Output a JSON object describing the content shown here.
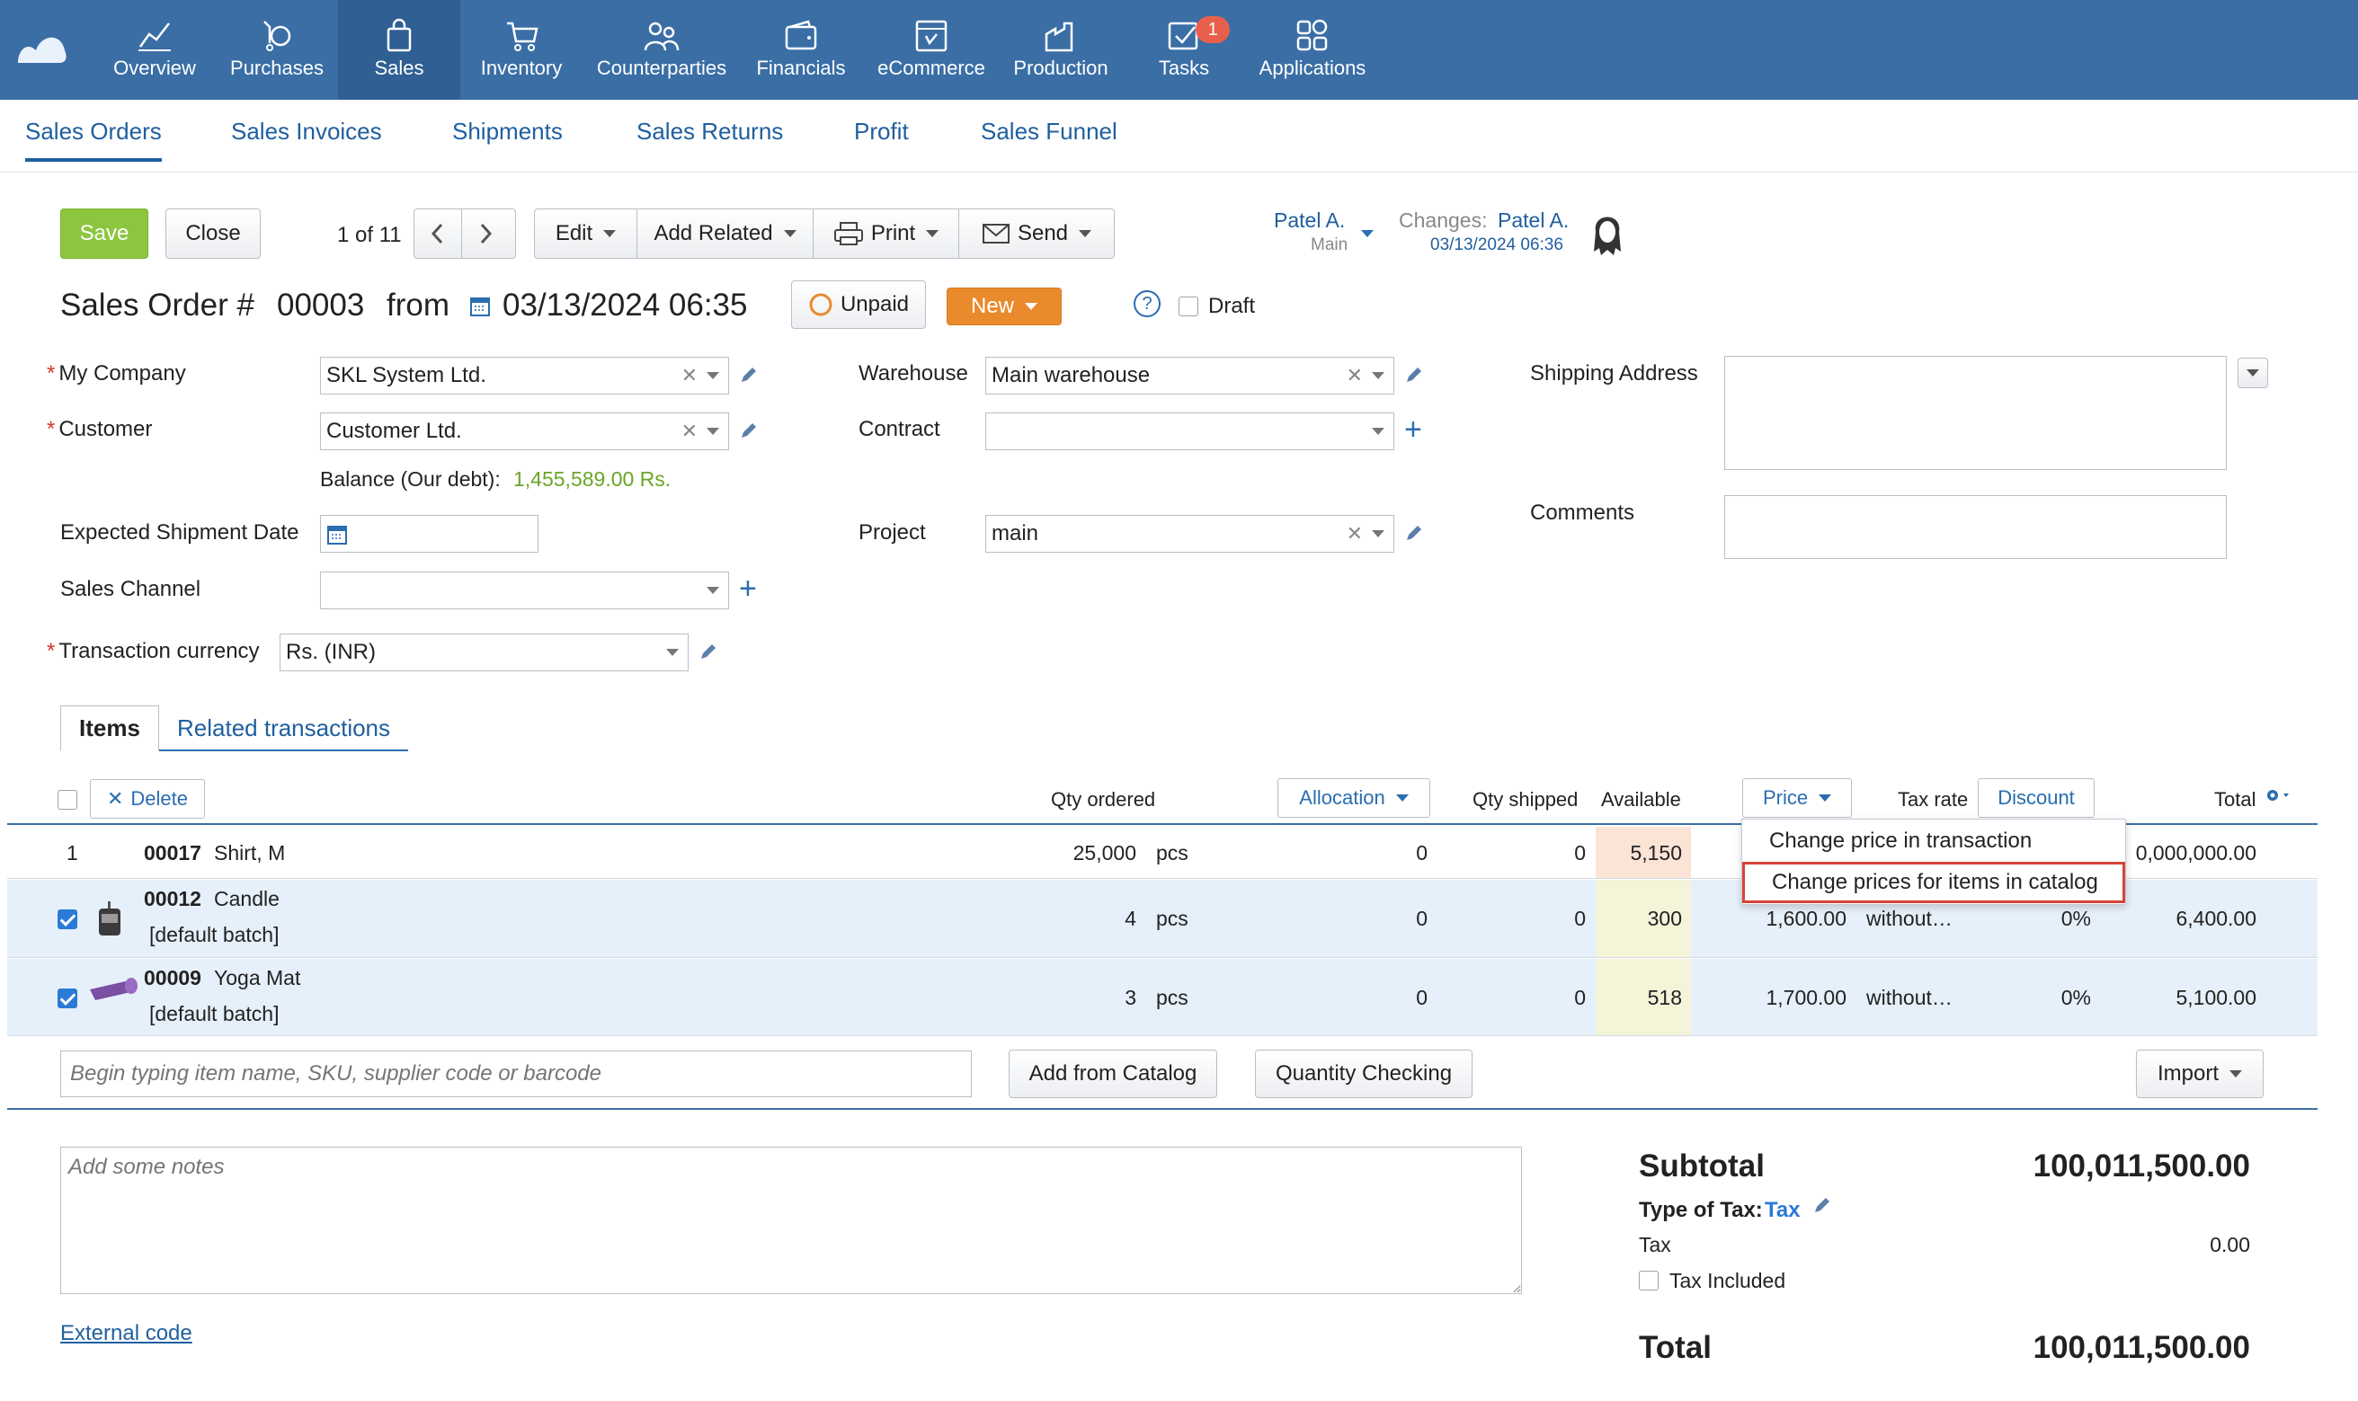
{
  "nav": {
    "items": [
      {
        "key": "overview",
        "label": "Overview",
        "icon": "chart-line-icon"
      },
      {
        "key": "purchases",
        "label": "Purchases",
        "icon": "purchases-icon"
      },
      {
        "key": "sales",
        "label": "Sales",
        "icon": "shopping-bag-icon",
        "active": true
      },
      {
        "key": "inventory",
        "label": "Inventory",
        "icon": "cart-icon"
      },
      {
        "key": "counterparties",
        "label": "Counterparties",
        "icon": "people-icon"
      },
      {
        "key": "financials",
        "label": "Financials",
        "icon": "wallet-icon"
      },
      {
        "key": "ecommerce",
        "label": "eCommerce",
        "icon": "store-icon"
      },
      {
        "key": "production",
        "label": "Production",
        "icon": "factory-icon"
      },
      {
        "key": "tasks",
        "label": "Tasks",
        "icon": "check-box-icon",
        "badge": "1"
      },
      {
        "key": "applications",
        "label": "Applications",
        "icon": "apps-grid-icon"
      }
    ]
  },
  "subnav": {
    "tabs": [
      "Sales Orders",
      "Sales Invoices",
      "Shipments",
      "Sales Returns",
      "Profit",
      "Sales Funnel"
    ]
  },
  "toolbar": {
    "save": "Save",
    "close": "Close",
    "pager": "1 of 11",
    "edit": "Edit",
    "add_related": "Add Related",
    "print": "Print",
    "send": "Send",
    "owner_name": "Patel A.",
    "owner_dept": "Main",
    "changes_label": "Changes:",
    "changes_user": "Patel A.",
    "changes_date": "03/13/2024 06:36"
  },
  "doc": {
    "title_prefix": "Sales Order #",
    "number": "00003",
    "from_label": "from",
    "datetime": "03/13/2024 06:35",
    "payment_status": "Unpaid",
    "status": "New",
    "draft_label": "Draft",
    "help": "?"
  },
  "form": {
    "my_company_label": "My Company",
    "my_company": "SKL System Ltd.",
    "customer_label": "Customer",
    "customer": "Customer Ltd.",
    "balance_label": "Balance (Our debt):",
    "balance_value": "1,455,589.00 Rs.",
    "expected_shipment_label": "Expected Shipment Date",
    "sales_channel_label": "Sales Channel",
    "currency_label": "Transaction currency",
    "currency": "Rs. (INR)",
    "warehouse_label": "Warehouse",
    "warehouse": "Main warehouse",
    "contract_label": "Contract",
    "project_label": "Project",
    "project": "main",
    "shipping_address_label": "Shipping Address",
    "comments_label": "Comments"
  },
  "tabs": {
    "items": "Items",
    "related": "Related transactions"
  },
  "table": {
    "delete": "Delete",
    "qty_ordered": "Qty ordered",
    "allocation": "Allocation",
    "qty_shipped": "Qty shipped",
    "available": "Available",
    "price": "Price",
    "tax_rate": "Tax rate",
    "discount": "Discount",
    "total": "Total",
    "rows": [
      {
        "index": "1",
        "code": "00017",
        "name": "Shirt, M",
        "batch": "",
        "qty": "25,000",
        "unit": "pcs",
        "allocation": "0",
        "shipped": "0",
        "available": "5,150",
        "price": "",
        "tax": "",
        "rate": "",
        "total": "0,000,000.00",
        "checked": false
      },
      {
        "index": "",
        "code": "00012",
        "name": "Candle",
        "batch": "[default batch]",
        "qty": "4",
        "unit": "pcs",
        "allocation": "0",
        "shipped": "0",
        "available": "300",
        "price": "1,600.00",
        "tax": "without…",
        "rate": "0%",
        "total": "6,400.00",
        "checked": true
      },
      {
        "index": "",
        "code": "00009",
        "name": "Yoga Mat",
        "batch": "[default batch]",
        "qty": "3",
        "unit": "pcs",
        "allocation": "0",
        "shipped": "0",
        "available": "518",
        "price": "1,700.00",
        "tax": "without…",
        "rate": "0%",
        "total": "5,100.00",
        "checked": true
      }
    ],
    "search_placeholder": "Begin typing item name, SKU, supplier code or barcode",
    "add_from_catalog": "Add from Catalog",
    "quantity_checking": "Quantity Checking",
    "import": "Import"
  },
  "price_menu": {
    "items": [
      "Change price in transaction",
      "Change prices for items in catalog"
    ]
  },
  "footer": {
    "notes_placeholder": "Add some notes",
    "external_code": "External code",
    "subtotal_label": "Subtotal",
    "subtotal": "100,011,500.00",
    "type_of_tax_label": "Type of Tax:",
    "type_of_tax": "Tax",
    "tax_label": "Tax",
    "tax": "0.00",
    "tax_included": "Tax Included",
    "total_label": "Total",
    "total": "100,011,500.00"
  },
  "colors": {
    "nav_bg": "#3a6ea5",
    "nav_active": "#2f5f93",
    "link": "#1f5f9f",
    "save": "#8cc63f",
    "status_new": "#e98a2c",
    "balance": "#6aa527",
    "available_high": "#fbe3d6",
    "available_ok": "#f3f4d8",
    "highlight": "#d8433a"
  }
}
